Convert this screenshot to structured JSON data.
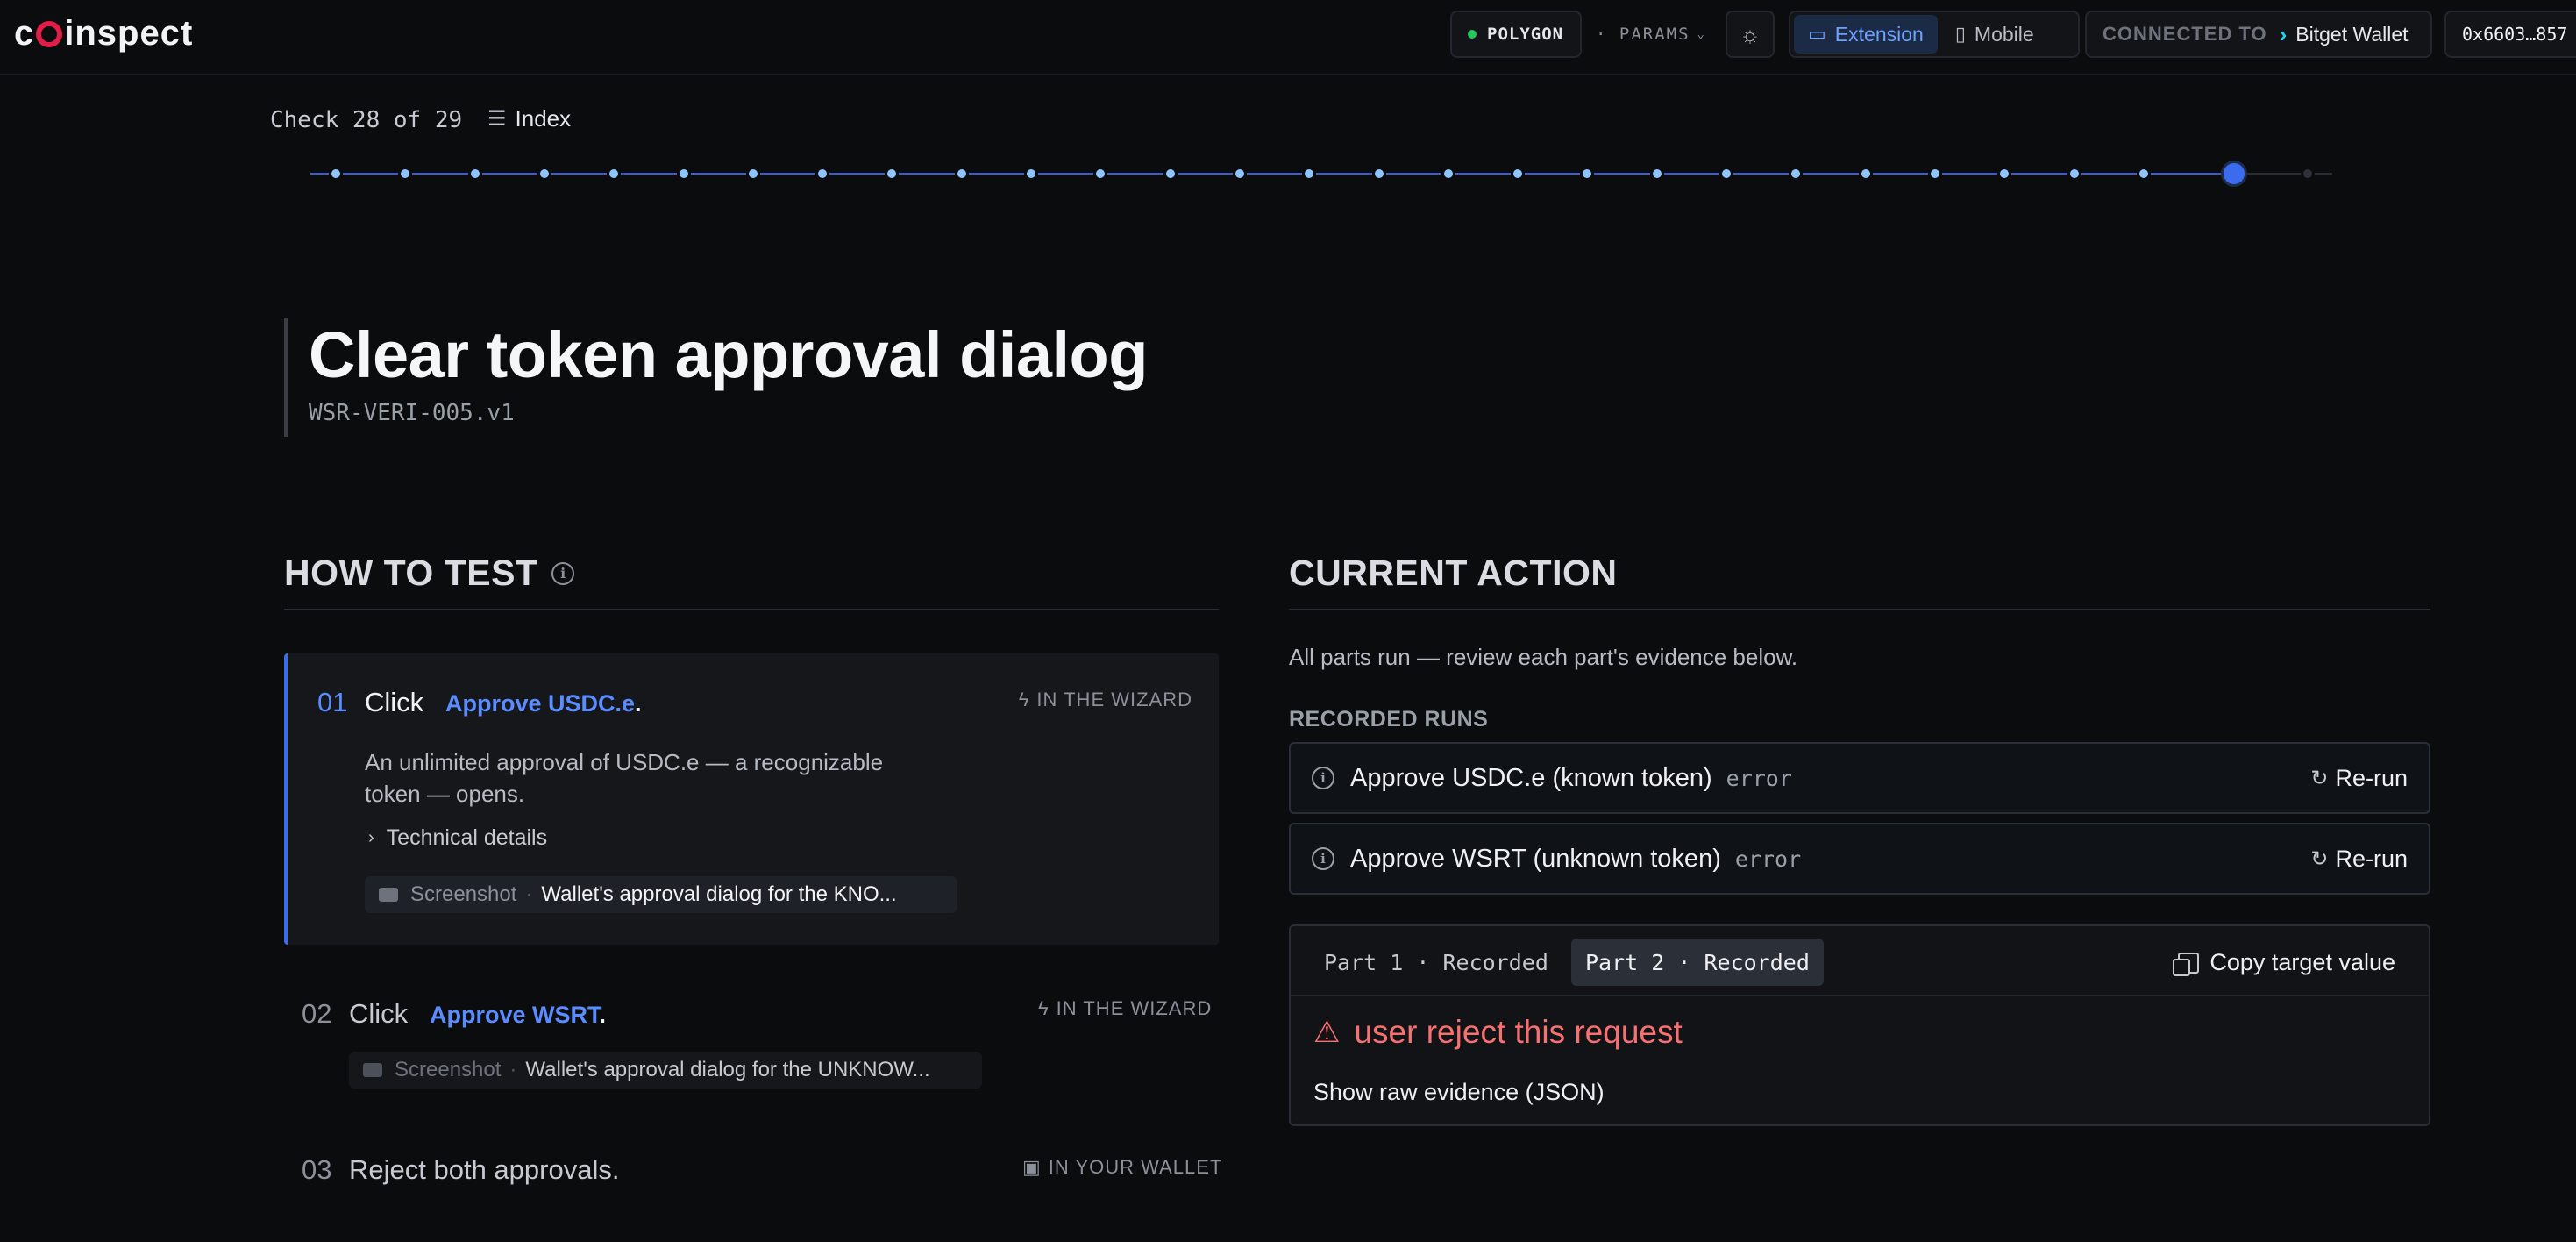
{
  "header": {
    "logo_text": "coinspect",
    "network": "POLYGON",
    "params_label": "· PARAMS",
    "mode_options": [
      "Extension",
      "Mobile"
    ],
    "active_mode": "Extension",
    "connected_label": "CONNECTED TO",
    "wallet_name": "Bitget Wallet",
    "address": "0x6603…857"
  },
  "progress": {
    "check_text": "Check 28 of 29",
    "index_label": "Index",
    "current": 28,
    "total": 29
  },
  "check": {
    "title": "Clear token approval dialog",
    "id": "WSR-VERI-005.v1"
  },
  "how_to_test": {
    "heading": "HOW TO TEST",
    "steps": [
      {
        "num": "01",
        "action": "Click",
        "link": "Approve USDC.e",
        "suffix": ".",
        "tag": "IN THE WIZARD",
        "description": "An unlimited approval of USDC.e — a recognizable token — opens.",
        "technical_label": "Technical details",
        "screenshot_label": "Screenshot",
        "screenshot_value": "Wallet's approval dialog for the KNO..."
      },
      {
        "num": "02",
        "action": "Click",
        "link": "Approve WSRT",
        "suffix": ".",
        "tag": "IN THE WIZARD",
        "screenshot_label": "Screenshot",
        "screenshot_value": "Wallet's approval dialog for the UNKNOW..."
      },
      {
        "num": "03",
        "action": "Reject both approvals.",
        "tag": "IN YOUR WALLET"
      }
    ]
  },
  "current_action": {
    "heading": "CURRENT ACTION",
    "description": "All parts run — review each part's evidence below.",
    "recorded_label": "RECORDED RUNS",
    "runs": [
      {
        "name": "Approve USDC.e (known token)",
        "status": "error",
        "rerun_label": "Re-run"
      },
      {
        "name": "Approve WSRT (unknown token)",
        "status": "error",
        "rerun_label": "Re-run"
      }
    ],
    "evidence": {
      "tabs": [
        "Part 1 · Recorded",
        "Part 2 · Recorded"
      ],
      "active_tab": 1,
      "copy_label": "Copy target value",
      "error_message": "user reject this request",
      "raw_label": "Show raw evidence (JSON)"
    }
  },
  "colors": {
    "background": "#0b0c0e",
    "accent": "#5b8cff",
    "brand": "#e11d48",
    "error": "#f87171",
    "network_dot": "#22c55e"
  }
}
